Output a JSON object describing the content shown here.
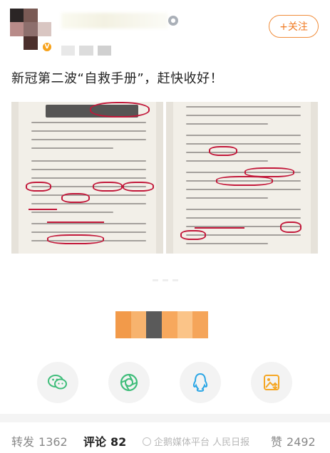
{
  "header": {
    "follow_label": "+关注",
    "badge_icon": "v-badge-icon"
  },
  "post": {
    "text": "新冠第二波“自救手册”，赶快收好！"
  },
  "photos": {
    "left": {
      "phrases": [
        "38.3",
        "止咳器",
        "38.3",
        "吃止者",
        "消炎药"
      ]
    },
    "right": {
      "phrases": [
        "清热",
        "用药",
        "补",
        "蒲"
      ]
    }
  },
  "share": {
    "items": [
      {
        "name": "wechat-icon",
        "color": "#3fbd7a"
      },
      {
        "name": "moments-icon",
        "color": "#3fbd7a"
      },
      {
        "name": "qq-icon",
        "color": "#2aa6e6"
      },
      {
        "name": "save-image-icon",
        "color": "#f5a623"
      }
    ]
  },
  "stats": {
    "repost_label": "转发",
    "repost_count": "1362",
    "comment_label": "评论",
    "comment_count": "82",
    "like_label": "赞",
    "like_count": "2492"
  },
  "watermark": {
    "text": "企鹅媒体平台 人民日报"
  },
  "colors": {
    "accent": "#f07a22",
    "ink_red": "#c2183a"
  }
}
